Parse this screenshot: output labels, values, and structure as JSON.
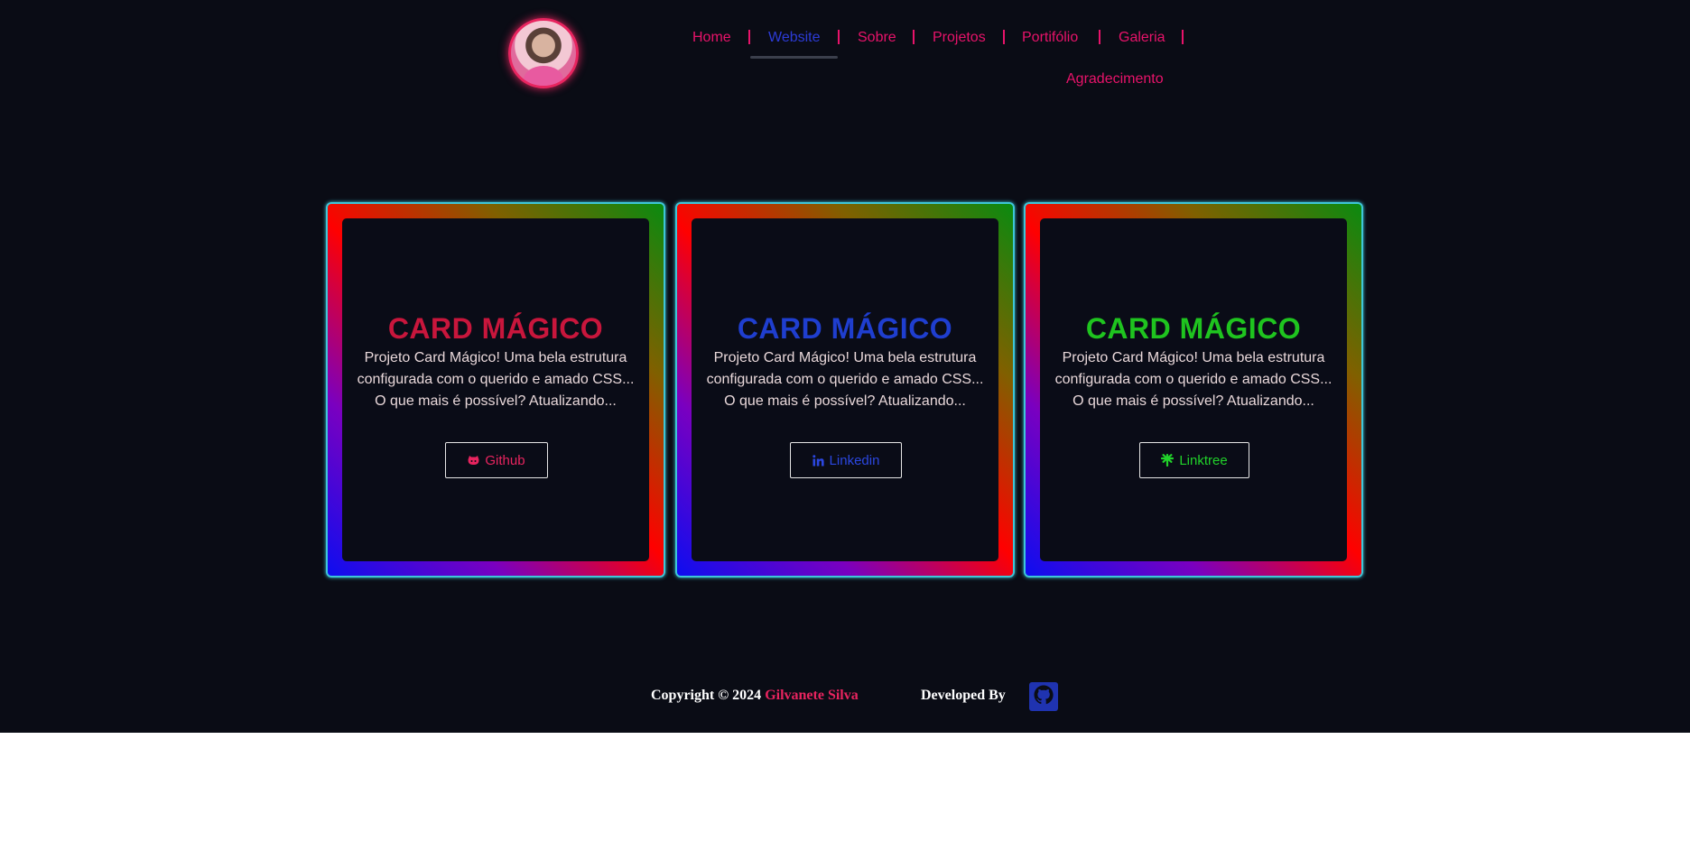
{
  "nav": {
    "items": [
      {
        "label": "Home"
      },
      {
        "label": "Website"
      },
      {
        "label": "Sobre"
      },
      {
        "label": "Projetos"
      },
      {
        "label": "Portifólio"
      },
      {
        "label": "Galeria"
      },
      {
        "label": "Agradecimento"
      }
    ],
    "active_item": "Website"
  },
  "cards": [
    {
      "title": "CARD MÁGICO",
      "title_color": "#c8163c",
      "line1": "Projeto Card Mágico! Uma bela estrutura",
      "line2": "configurada com o querido e amado CSS...",
      "line3": "O que mais é possível? Atualizando...",
      "button_label": "Github",
      "button_icon": "github-icon",
      "button_color": "#e8245f"
    },
    {
      "title": "CARD MÁGICO",
      "title_color": "#1f3ecf",
      "line1": "Projeto Card Mágico! Uma bela estrutura",
      "line2": "configurada com o querido e amado CSS...",
      "line3": "O que mais é possível? Atualizando...",
      "button_label": "Linkedin",
      "button_icon": "linkedin-icon",
      "button_color": "#2b47e0"
    },
    {
      "title": "CARD MÁGICO",
      "title_color": "#1fc41f",
      "line1": "Projeto Card Mágico! Uma bela estrutura",
      "line2": "configurada com o querido e amado CSS...",
      "line3": "O que mais é possível? Atualizando...",
      "button_label": "Linktree",
      "button_icon": "linktree-icon",
      "button_color": "#21d12a"
    }
  ],
  "footer": {
    "copyright_prefix": "Copyright © 2024",
    "author": "Gilvanete Silva",
    "developed_by": "Developed By",
    "github_icon": "github-icon"
  },
  "colors": {
    "background": "#0a0c15",
    "nav_link": "#e8136a",
    "nav_active": "#2c3bd6",
    "card_border": "#3ec6d8"
  }
}
